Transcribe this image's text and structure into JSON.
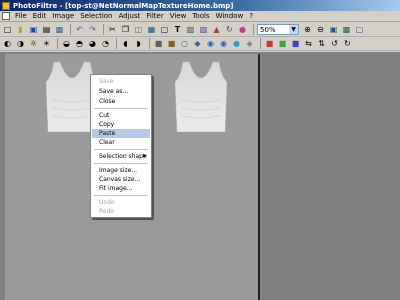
{
  "window": {
    "title": "PhotoFiltre - [top-st@NetNormalMapTextureHome.bmp]"
  },
  "menubar": {
    "items": [
      "File",
      "Edit",
      "Image",
      "Selection",
      "Adjust",
      "Filter",
      "View",
      "Tools",
      "Window",
      "?"
    ]
  },
  "toolbar": {
    "zoom_value": "50%"
  },
  "context_menu": {
    "items": [
      {
        "label": "Save",
        "state": "disabled"
      },
      {
        "label": "Save as...",
        "state": "enabled"
      },
      {
        "label": "Close",
        "state": "enabled"
      },
      {
        "label": "Cut",
        "state": "enabled"
      },
      {
        "label": "Copy",
        "state": "enabled"
      },
      {
        "label": "Paste",
        "state": "highlighted"
      },
      {
        "label": "Clear",
        "state": "enabled"
      },
      {
        "label": "Selection shape",
        "state": "submenu"
      },
      {
        "label": "Image size...",
        "state": "enabled"
      },
      {
        "label": "Canvas size...",
        "state": "enabled"
      },
      {
        "label": "Fit image...",
        "state": "enabled"
      },
      {
        "label": "Undo",
        "state": "disabled"
      },
      {
        "label": "Redo",
        "state": "disabled"
      }
    ]
  },
  "colors": {
    "title_gradient_start": "#0a246a",
    "workspace": "#808080",
    "canvas": "#9a9a9a",
    "menu_highlight": "#b7c8e6"
  }
}
